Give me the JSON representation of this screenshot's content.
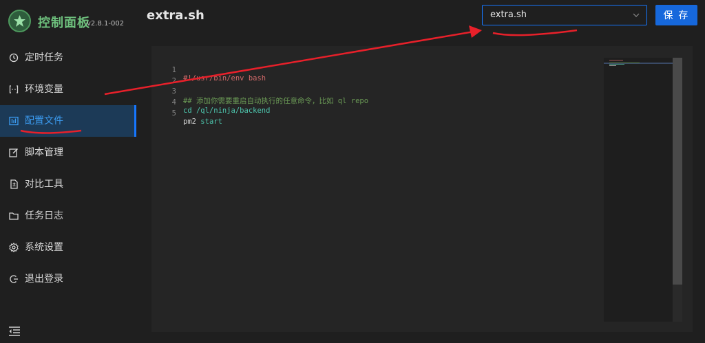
{
  "brand": {
    "title": "控制面板",
    "version": "v2.8.1-002"
  },
  "sidebar": {
    "items": [
      {
        "label": "定时任务",
        "icon": "clock-icon"
      },
      {
        "label": "环境变量",
        "icon": "variable-icon"
      },
      {
        "label": "配置文件",
        "icon": "config-file-icon",
        "active": true
      },
      {
        "label": "脚本管理",
        "icon": "edit-icon"
      },
      {
        "label": "对比工具",
        "icon": "diff-icon"
      },
      {
        "label": "任务日志",
        "icon": "folder-icon"
      },
      {
        "label": "系统设置",
        "icon": "gear-icon"
      },
      {
        "label": "退出登录",
        "icon": "logout-icon"
      }
    ]
  },
  "header": {
    "title": "extra.sh",
    "file_select": {
      "value": "extra.sh"
    },
    "save_label": "保 存"
  },
  "editor": {
    "lines": [
      {
        "n": "1",
        "text": "#!/usr/bin/env bash",
        "kind": "shebang"
      },
      {
        "n": "2",
        "text": "",
        "kind": "plain"
      },
      {
        "n": "3",
        "text": "## 添加你需要重启自动执行的任意命令，比如 ql repo",
        "kind": "comment"
      },
      {
        "n": "4",
        "text": "cd /ql/ninja/backend",
        "kind": "cmd"
      },
      {
        "n": "5",
        "text": "pm2 start",
        "kind": "pm2"
      }
    ]
  },
  "colors": {
    "accent": "#1677ff",
    "active_bg": "#1c3a57",
    "annotation": "#e8202a",
    "brand_green": "#6ec07d"
  }
}
